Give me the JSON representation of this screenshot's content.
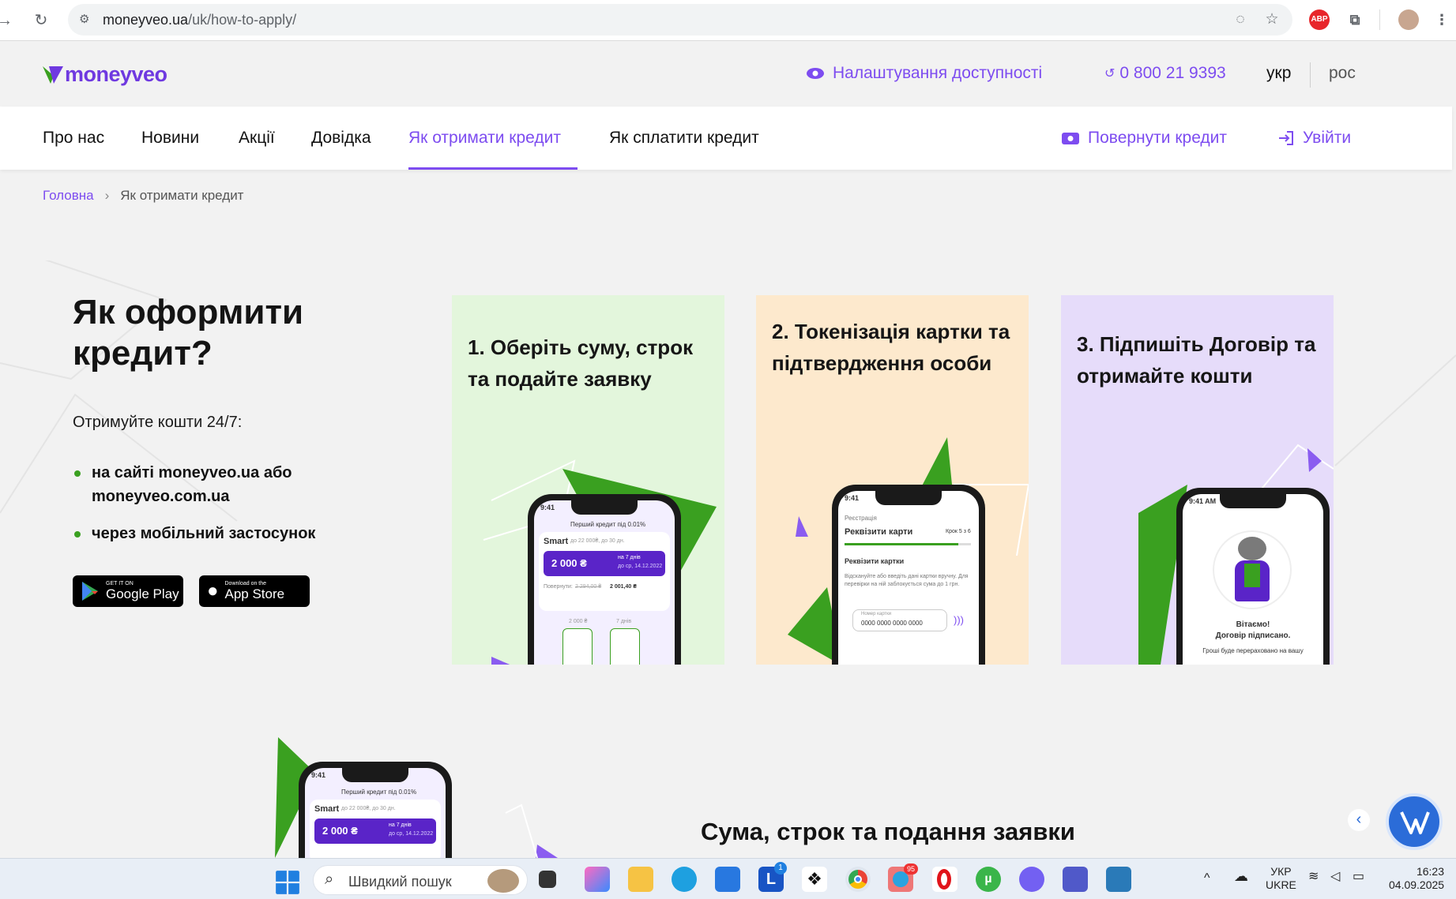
{
  "browser": {
    "url_host": "moneyveo.ua",
    "url_path": "/uk/how-to-apply/"
  },
  "header": {
    "logo_text": "moneyveo",
    "accessibility_label": "Налаштування доступності",
    "phone": "0 800 21 9393",
    "lang_active": "укр",
    "lang_other": "рос"
  },
  "nav": {
    "items": [
      "Про нас",
      "Новини",
      "Акції",
      "Довідка",
      "Як отримати кредит",
      "Як сплатити кредит"
    ],
    "repay_label": "Повернути кредит",
    "login_label": "Увійти"
  },
  "breadcrumb": {
    "home": "Головна",
    "separator": "›",
    "current": "Як отримати кредит"
  },
  "hero": {
    "title": "Як оформити кредит?",
    "lead": "Отримуйте кошти 24/7:",
    "bullets": [
      "на сайті moneyveo.ua або moneyveo.com.ua",
      "через мобільний застосунок"
    ],
    "google_play_small": "GET IT ON",
    "google_play_big": "Google Play",
    "app_store_small": "Download on the",
    "app_store_big": "App Store"
  },
  "steps": [
    {
      "title": "1. Оберіть суму, строк та подайте заявку",
      "bg": "#e3f6dc",
      "phone": {
        "time": "9:41",
        "promo": "Перший кредит під 0.01%",
        "product": "Smart",
        "product_hint": "до 22 000₴, до 30 дн.",
        "amount": "2 000 ₴",
        "term": "на 7 днів",
        "due": "до ср, 14.12.2022",
        "repay_label": "Повернути:",
        "repay_old": "2 294,00 ₴",
        "repay_new": "2 001,40 ₴",
        "slider_a": "2 000 ₴",
        "slider_b": "7 днів"
      }
    },
    {
      "title": "2. Токенізація картки та підтвердження особи",
      "bg": "#fde9cd",
      "phone": {
        "time": "9:41",
        "section": "Реєстрація",
        "heading": "Реквізити карти",
        "step": "Крок 5 з 6",
        "subheading": "Реквізити картки",
        "note": "Відскануйте або введіть дані картки вручну. Для перевірки на ній заблокується сума до 1 грн.",
        "field_label": "Номер картки",
        "field_value": "0000 0000 0000 0000"
      }
    },
    {
      "title": "3. Підпишіть Договір та отримайте кошти",
      "bg": "#e6dcfa",
      "phone": {
        "time": "9:41 AM",
        "line1": "Вітаємо!",
        "line2": "Договір підписано.",
        "line3": "Гроші буде перераховано на вашу"
      }
    }
  ],
  "bottom": {
    "section_title": "Сума, строк та подання заявки",
    "phone": {
      "time": "9:41",
      "promo": "Перший кредит під 0.01%",
      "product": "Smart",
      "product_hint": "до 22 000₴, до 30 дн.",
      "amount": "2 000 ₴",
      "term": "на 7 днів",
      "due": "до ср, 14.12.2022"
    }
  },
  "taskbar": {
    "search_placeholder": "Швидкий пошук",
    "lang_top": "УКР",
    "lang_bottom": "UKRE",
    "time": "16:23",
    "date": "04.09.2025",
    "telegram_badge": "95",
    "badge_l": "1"
  },
  "colors": {
    "accent": "#7d4cf0",
    "green": "#3aa020",
    "card1": "#e3f6dc",
    "card2": "#fde9cd",
    "card3": "#e6dcfa"
  }
}
